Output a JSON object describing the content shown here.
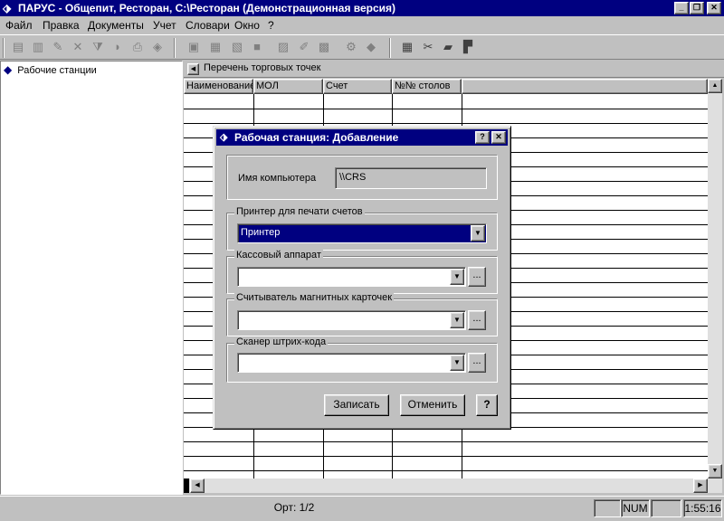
{
  "window": {
    "title": "ПАРУС - Общепит, Ресторан, С:\\Ресторан (Демонстрационная версия)"
  },
  "menu": {
    "items": [
      {
        "label": "Файл"
      },
      {
        "label": "Правка"
      },
      {
        "label": "Документы"
      },
      {
        "label": "Учет"
      },
      {
        "label": "Словари"
      },
      {
        "label": "Окно"
      },
      {
        "label": "?"
      }
    ]
  },
  "tree": {
    "root_label": "Рабочие станции"
  },
  "list": {
    "header_title": "Перечень торговых точек",
    "columns": [
      "Наименование",
      "МОЛ",
      "Счет",
      "№№ столов"
    ]
  },
  "dialog": {
    "title": "Рабочая станция: Добавление",
    "help_glyph": "?",
    "close_glyph": "✕",
    "computer_label": "Имя компьютера",
    "computer_value": "\\\\CRS",
    "printer_group": "Принтер для печати счетов",
    "printer_value": "Принтер",
    "cash_group": "Кассовый аппарат",
    "cash_value": "",
    "card_group": "Считыватель магнитных карточек",
    "card_value": "",
    "scanner_group": "Сканер штрих-кода",
    "scanner_value": "",
    "browse_label": "...",
    "save_label": "Записать",
    "cancel_label": "Отменить",
    "help_label": "?"
  },
  "status": {
    "record": "Орт: 1/2",
    "num": "NUM",
    "time": "1:55:16"
  },
  "colors": {
    "title_bg": "#000080",
    "face": "#c0c0c0",
    "selection": "#000080"
  }
}
